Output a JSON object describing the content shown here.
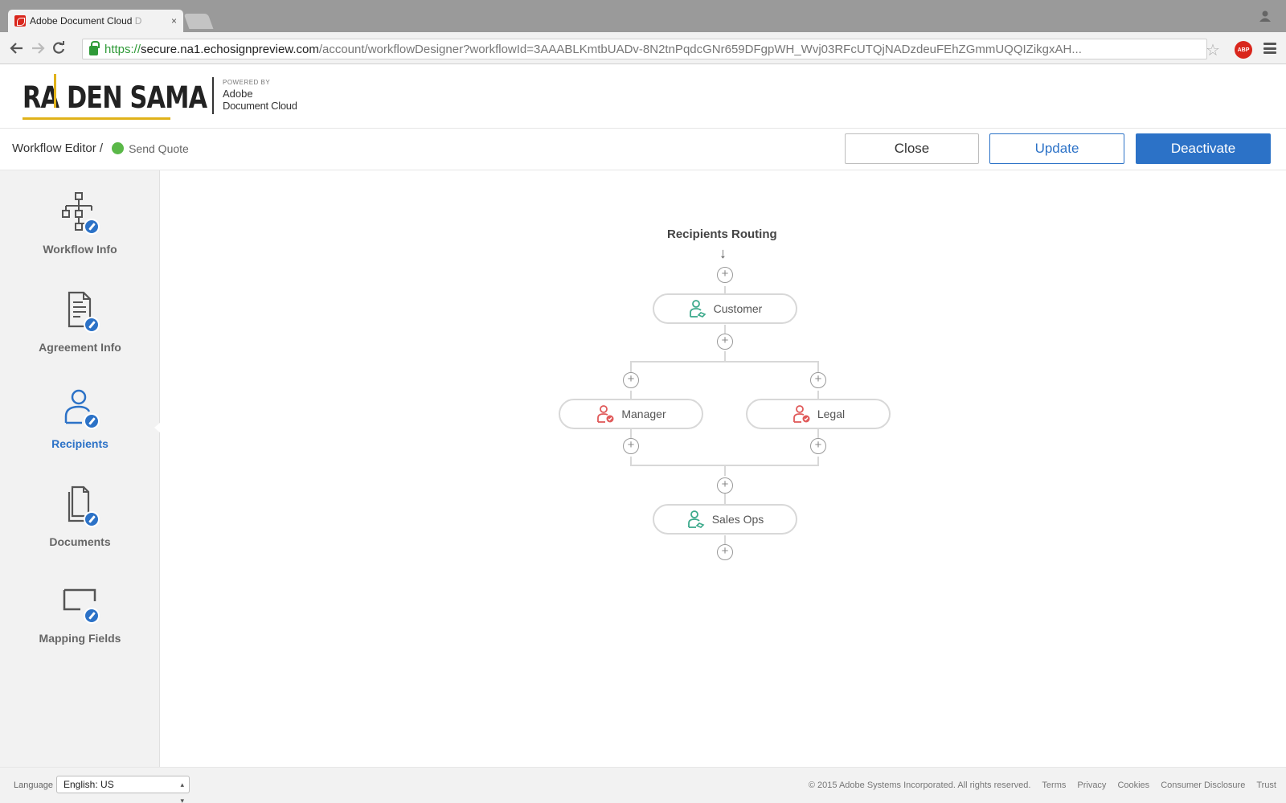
{
  "browser": {
    "tab_title": "Adobe Document Cloud",
    "tab_title_overflow": "D",
    "tab_close": "×",
    "url_scheme": "https://",
    "url_host": "secure.na1.echosignpreview.com",
    "url_path": "/account/workflowDesigner?workflowId=3AAABLKmtbUADv-8N2tnPqdcGNr659DFgpWH_Wvj03RFcUTQjNADzdeuFEhZGmmUQQIZikgxAH...",
    "abp_label": "ABP"
  },
  "header": {
    "logo_text": "RA DEN SAMA",
    "powered_by": "POWERED BY",
    "powered_line1": "Adobe",
    "powered_line2": "Document Cloud"
  },
  "subheader": {
    "breadcrumb_root": "Workflow Editor /",
    "workflow_name": "Send Quote",
    "status_color": "#5ab848"
  },
  "actions": {
    "close_label": "Close",
    "update_label": "Update",
    "deactivate_label": "Deactivate"
  },
  "sidebar": {
    "items": [
      {
        "label": "Workflow Info",
        "icon": "workflow-icon",
        "active": false
      },
      {
        "label": "Agreement Info",
        "icon": "agreement-icon",
        "active": false
      },
      {
        "label": "Recipients",
        "icon": "recipients-icon",
        "active": true
      },
      {
        "label": "Documents",
        "icon": "documents-icon",
        "active": false
      },
      {
        "label": "Mapping Fields",
        "icon": "mapping-fields-icon",
        "active": false
      }
    ]
  },
  "routing": {
    "title": "Recipients Routing",
    "arrow": "↓",
    "plus": "+",
    "nodes": [
      {
        "label": "Customer",
        "role": "signer",
        "color": "#3daa8c"
      },
      {
        "label": "Manager",
        "role": "approver",
        "color": "#e05a5a"
      },
      {
        "label": "Legal",
        "role": "approver",
        "color": "#e05a5a"
      },
      {
        "label": "Sales Ops",
        "role": "signer",
        "color": "#3daa8c"
      }
    ]
  },
  "footer": {
    "language_label": "Language",
    "language_value": "English: US",
    "copyright": "© 2015 Adobe Systems Incorporated. All rights reserved.",
    "links": [
      "Terms",
      "Privacy",
      "Cookies",
      "Consumer Disclosure",
      "Trust"
    ]
  },
  "colors": {
    "accent": "#2c72c7",
    "logo_accent": "#e0b21a",
    "sidebar_bg": "#f2f2f2"
  }
}
